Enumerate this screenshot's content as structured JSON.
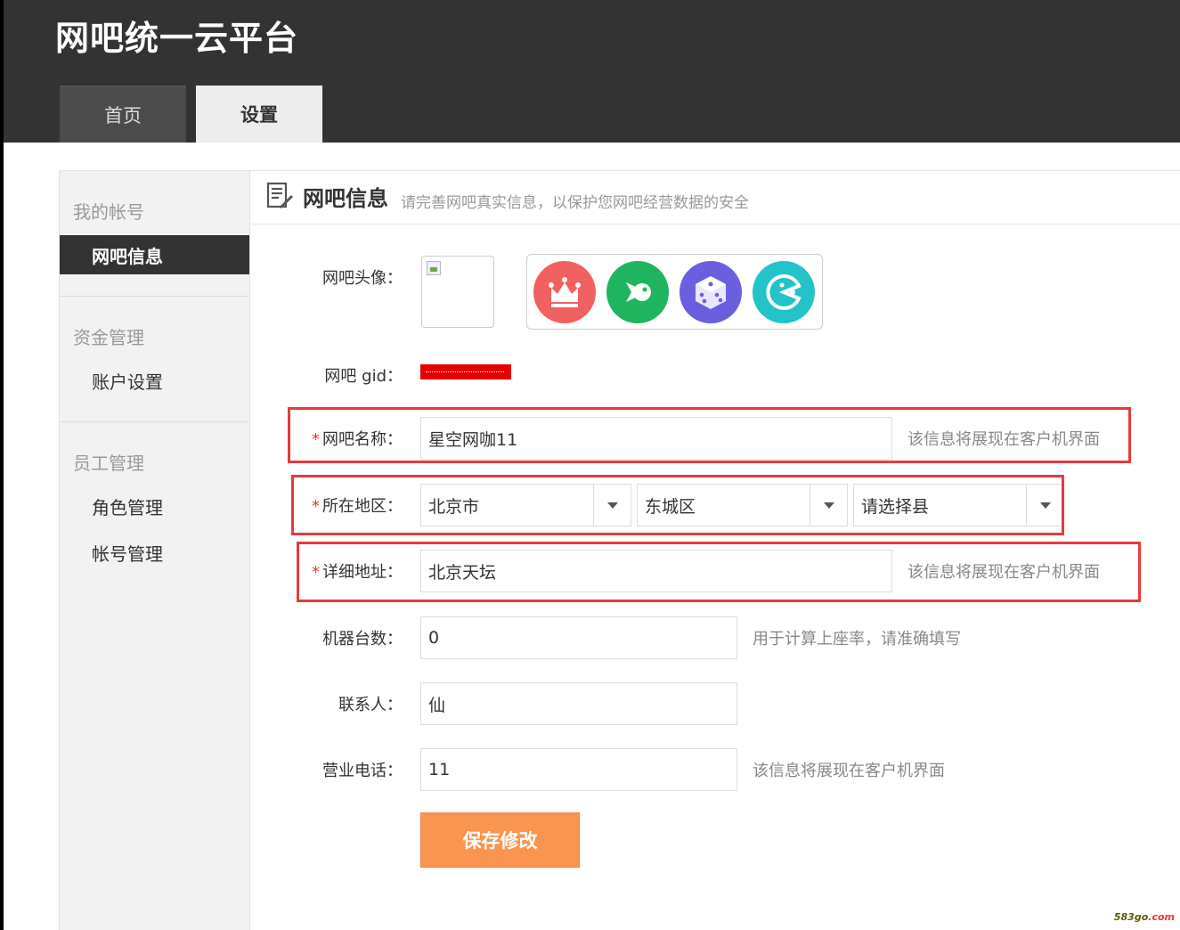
{
  "app": {
    "title": "网吧统一云平台"
  },
  "tabs": [
    {
      "label": "首页",
      "active": false
    },
    {
      "label": "设置",
      "active": true
    }
  ],
  "sidebar": {
    "groups": [
      {
        "title": "我的帐号",
        "items": [
          {
            "label": "网吧信息",
            "active": true
          }
        ]
      },
      {
        "title": "资金管理",
        "items": [
          {
            "label": "账户设置",
            "active": false
          }
        ]
      },
      {
        "title": "员工管理",
        "items": [
          {
            "label": "角色管理",
            "active": false
          },
          {
            "label": "帐号管理",
            "active": false
          }
        ]
      }
    ]
  },
  "section": {
    "title": "网吧信息",
    "subtitle": "请完善网吧真实信息，以保护您网吧经营数据的安全"
  },
  "form": {
    "avatar": {
      "label": "网吧头像：",
      "options": [
        "crown-avatar-icon",
        "fish-avatar-icon",
        "dice-avatar-icon",
        "pacman-avatar-icon"
      ],
      "option_colors": [
        "#f0615f",
        "#1fb45e",
        "#6b5fe0",
        "#23c3c9"
      ]
    },
    "gid": {
      "label": "网吧 gid："
    },
    "name": {
      "label": "网吧名称：",
      "required_mark": "*",
      "value": "星空网咖11",
      "hint": "该信息将展现在客户机界面"
    },
    "region": {
      "label": "所在地区：",
      "required_mark": "*",
      "province": "北京市",
      "district": "东城区",
      "county": "请选择县"
    },
    "address": {
      "label": "详细地址：",
      "required_mark": "*",
      "value": "北京天坛",
      "hint": "该信息将展现在客户机界面"
    },
    "machines": {
      "label": "机器台数：",
      "value": "0",
      "hint": "用于计算上座率，请准确填写"
    },
    "contact": {
      "label": "联系人：",
      "value": "仙"
    },
    "phone": {
      "label": "营业电话：",
      "value": "11",
      "hint": "该信息将展现在客户机界面"
    },
    "save_label": "保存修改"
  },
  "watermark": {
    "text": "583go",
    "suffix": ".com"
  },
  "colors": {
    "header_bg": "#333333",
    "accent_orange": "#f9954f",
    "highlight_red": "#e8393c",
    "sidebar_active": "#333333"
  }
}
